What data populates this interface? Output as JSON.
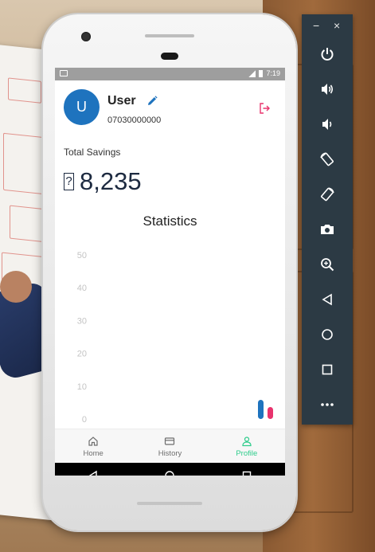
{
  "status_bar": {
    "time": "7:19"
  },
  "profile": {
    "avatar_initial": "U",
    "name": "User",
    "phone": "07030000000"
  },
  "savings": {
    "label": "Total Savings",
    "currency_glyph": "?",
    "amount": "8,235"
  },
  "chart_data": {
    "type": "bar",
    "title": "Statistics",
    "xlabel": "",
    "ylabel": "",
    "ylim": [
      0,
      50
    ],
    "y_ticks": [
      50,
      40,
      30,
      20,
      10,
      0
    ],
    "categories": [],
    "values": [],
    "grid": false
  },
  "bottom_nav": {
    "items": [
      {
        "label": "Home",
        "icon": "home-icon",
        "active": false
      },
      {
        "label": "History",
        "icon": "card-icon",
        "active": false
      },
      {
        "label": "Profile",
        "icon": "user-icon",
        "active": true
      }
    ]
  },
  "colors": {
    "accent": "#2ecc8b",
    "avatar_bg": "#1e73be",
    "logout": "#e8336d",
    "edit": "#1e73be"
  },
  "emulator": {
    "window_controls": {
      "minimize": "−",
      "close": "×"
    },
    "buttons": [
      "power-icon",
      "volume-up-icon",
      "volume-down-icon",
      "rotate-left-icon",
      "rotate-right-icon",
      "camera-icon",
      "zoom-icon",
      "back-icon",
      "home-circle-icon",
      "overview-icon",
      "more-icon"
    ]
  }
}
